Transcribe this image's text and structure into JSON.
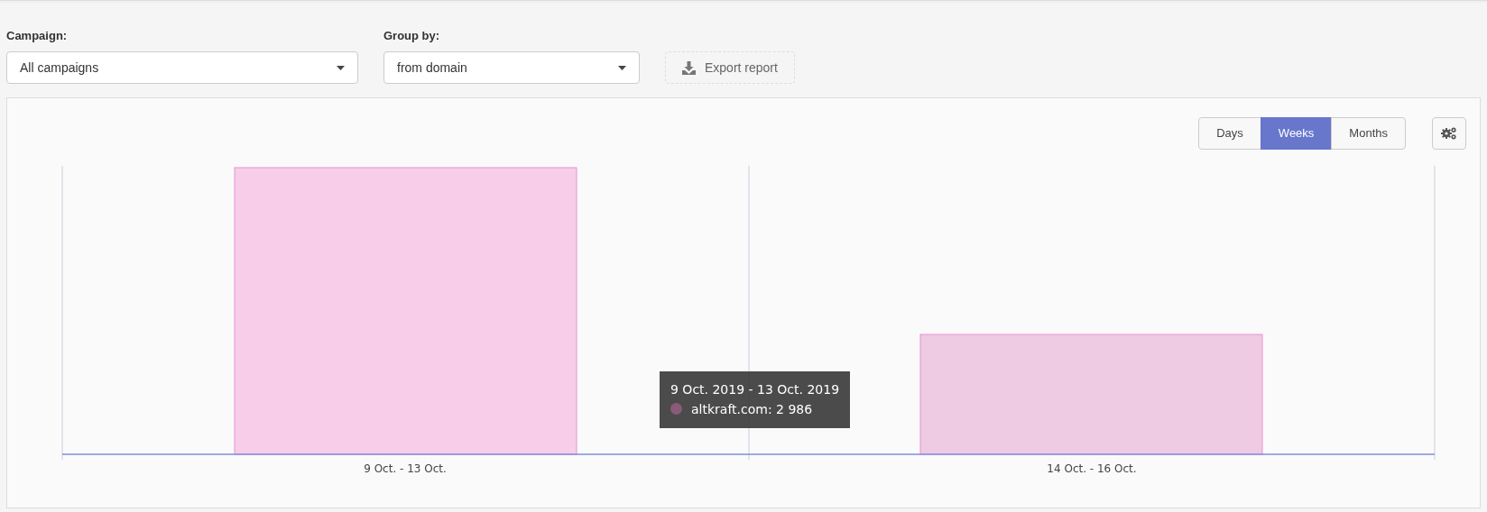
{
  "filters": [
    {
      "label": "Campaign:",
      "value": "All campaigns"
    },
    {
      "label": "Group by:",
      "value": "from domain"
    }
  ],
  "export_button": {
    "label": "Export report"
  },
  "period_tabs": [
    {
      "label": "Days",
      "selected": false
    },
    {
      "label": "Weeks",
      "selected": true
    },
    {
      "label": "Months",
      "selected": false
    }
  ],
  "chart": {
    "x_labels": [
      "9 Oct. - 13 Oct.",
      "14 Oct. - 16 Oct."
    ],
    "tooltip": {
      "title": "9 Oct. 2019 - 13 Oct. 2019",
      "entry": "altkraft.com: 2 986",
      "color": "#8a5a7a"
    }
  }
}
